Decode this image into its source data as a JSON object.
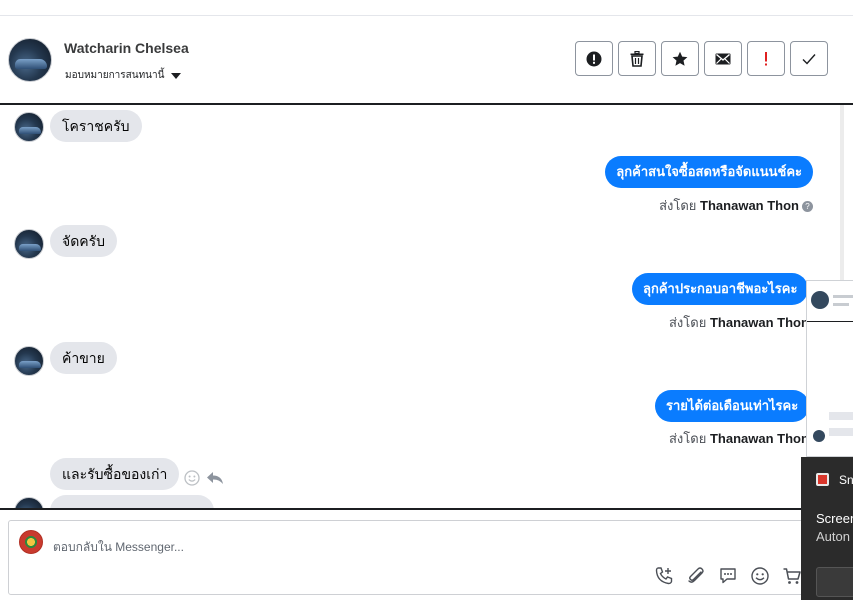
{
  "header": {
    "name": "Watcharin Chelsea",
    "assign_label": "มอบหมายการสนทนานี้",
    "actions": [
      {
        "icon": "alert-circle-icon",
        "label": "Mark as spam"
      },
      {
        "icon": "trash-icon",
        "label": "Delete"
      },
      {
        "icon": "star-icon",
        "label": "Star"
      },
      {
        "icon": "envelope-icon",
        "label": "Mark unread"
      },
      {
        "icon": "exclamation-icon",
        "label": "Follow up"
      },
      {
        "icon": "check-icon",
        "label": "Done"
      }
    ],
    "action_colors": {
      "default": "#1c1e21",
      "follow_up": "#e02020"
    }
  },
  "thread": {
    "messages": [
      {
        "dir": "in",
        "text": "โคราชครับ"
      },
      {
        "dir": "out",
        "text": "ลุกค้าสนใจซื้อสดหรือจัดแนนช์คะ",
        "sent_by_label": "ส่งโดย",
        "sender": "Thanawan Thon"
      },
      {
        "dir": "in",
        "text": "จัดครับ"
      },
      {
        "dir": "out",
        "text": "ลุกค้าประกอบอาชีพอะไรคะ",
        "sent_by_label": "ส่งโดย",
        "sender": "Thanawan Thon"
      },
      {
        "dir": "in",
        "text": "ค้าขาย"
      },
      {
        "dir": "out",
        "text": "รายได้ต่อเดือนเท่าไรคะ",
        "sent_by_label": "ส่งโดย",
        "sender": "Thanawan Thon"
      },
      {
        "dir": "in",
        "text": "และรับซื้อของเก่า"
      }
    ],
    "colors": {
      "outgoing": "#0a7cff",
      "incoming": "#e4e6eb"
    }
  },
  "composer": {
    "placeholder": "ตอบกลับใน Messenger...",
    "tools": [
      "call-add-icon",
      "paperclip-icon",
      "speech-bubble-icon",
      "emoji-icon",
      "cart-icon"
    ]
  },
  "overlay": {
    "snip_title": "Sn",
    "line1": "Screen",
    "line2": "Auton"
  }
}
